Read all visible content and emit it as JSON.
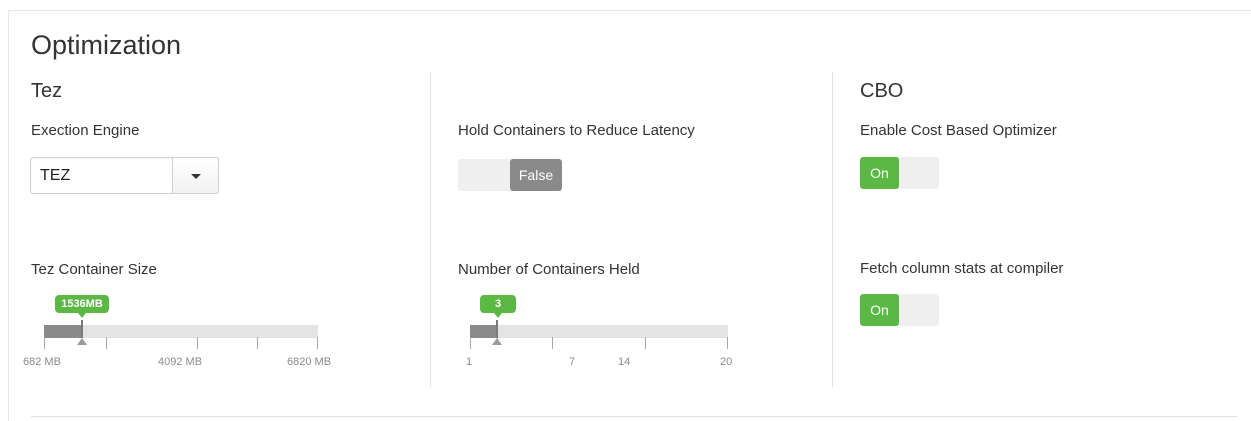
{
  "page": {
    "title": "Optimization"
  },
  "tez": {
    "section_title": "Tez",
    "engine": {
      "label": "Exection Engine",
      "value": "TEZ",
      "dropdown_icon": "caret-down-icon"
    },
    "container_size": {
      "label": "Tez Container Size",
      "value_label": "1536MB",
      "value": 1536,
      "min": 682,
      "max": 6820,
      "ticks": [
        "682 MB",
        "4092 MB",
        "6820 MB"
      ]
    }
  },
  "hold": {
    "label": "Hold Containers to Reduce Latency",
    "toggle_label": "False",
    "state": false
  },
  "containers_held": {
    "label": "Number of Containers Held",
    "value_label": "3",
    "value": 3,
    "min": 1,
    "max": 20,
    "ticks": [
      "1",
      "7",
      "14",
      "20"
    ]
  },
  "cbo": {
    "section_title": "CBO",
    "enable": {
      "label": "Enable Cost Based Optimizer",
      "toggle_label": "On",
      "state": true
    },
    "fetch_stats": {
      "label": "Fetch column stats at compiler",
      "toggle_label": "On",
      "state": true
    }
  },
  "colors": {
    "accent_green": "#5cb845",
    "toggle_off": "#8a8a8a",
    "slider_fill": "#8a8a8a",
    "slider_track": "#e4e4e4"
  }
}
